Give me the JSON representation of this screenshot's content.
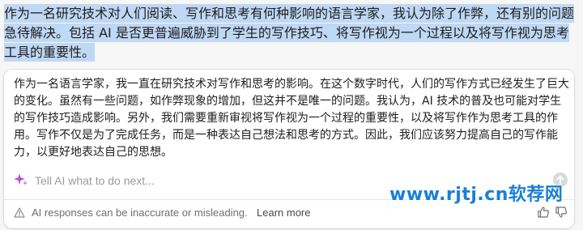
{
  "selected_text": "作为一名研究技术对人们阅读、写作和思考有何种影响的语言学家，我认为除了作弊，还有别的问题急待解决。包括 AI 是否更普遍威胁到了学生的写作技巧、将写作视为一个过程以及将写作视为思考工具的重要性。",
  "ai_panel": {
    "response": "作为一名语言学家，我一直在研究技术对写作和思考的影响。在这个数字时代，人们的写作方式已经发生了巨大的变化。虽然有一些问题，如作弊现象的增加，但这并不是唯一的问题。我认为，AI 技术的普及也可能对学生的写作技巧造成影响。另外，我们需要重新审视将写作视为一个过程的重要性，以及将写作作为思考工具的作用。写作不仅是为了完成任务，而是一种表达自己想法和思考的方式。因此，我们应该努力提高自己的写作能力，以更好地表达自己的思想。",
    "prompt_placeholder": "Tell AI what to do next...",
    "disclaimer": "AI responses can be inaccurate or misleading.",
    "learn_more": "Learn more"
  },
  "watermark": "www.rjtj.cn软荐网",
  "colors": {
    "selection": "#bfd8f3",
    "sparkle": "#b44fd6",
    "watermark": "#1a7fd6"
  },
  "icons": [
    "sparkle-icon",
    "send-arrow-icon",
    "warning-icon",
    "thumbs-up-icon",
    "thumbs-down-icon"
  ]
}
